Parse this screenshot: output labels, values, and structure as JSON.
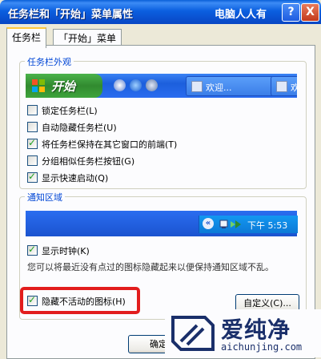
{
  "window": {
    "title": "任务栏和「开始」菜单属性",
    "watermark": "电脑人人有",
    "help_label": "?",
    "close_label": "X"
  },
  "tabs": [
    {
      "label": "任务栏",
      "active": true
    },
    {
      "label": "「开始」菜单",
      "active": false
    }
  ],
  "appearance": {
    "group_title": "任务栏外观",
    "preview": {
      "start_label": "开始",
      "tasks": [
        "欢迎...",
        "欢迎"
      ]
    },
    "options": [
      {
        "label": "锁定任务栏(L)",
        "checked": false
      },
      {
        "label": "自动隐藏任务栏(U)",
        "checked": false
      },
      {
        "label": "将任务栏保持在其它窗口的前端(T)",
        "checked": true
      },
      {
        "label": "分组相似任务栏按钮(G)",
        "checked": false
      },
      {
        "label": "显示快速启动(Q)",
        "checked": true
      }
    ]
  },
  "notification": {
    "group_title": "通知区域",
    "tray_chevron": "«",
    "tray_time": "下午 5:53",
    "show_clock": {
      "label": "显示时钟(K)",
      "checked": true
    },
    "description": "您可以将最近没有点过的图标隐藏起来以便保持通知区域不乱。",
    "hide_inactive": {
      "label": "隐藏不活动的图标(H)",
      "checked": true
    },
    "customize_label": "自定义(C)..."
  },
  "buttons": {
    "ok_label": "确定"
  },
  "logo": {
    "text": "爱纯净",
    "url": "aichunjing.com"
  },
  "colors": {
    "title_blue": "#0b5fe0",
    "start_green": "#3ea43c",
    "highlight_red": "#e21d1d"
  }
}
